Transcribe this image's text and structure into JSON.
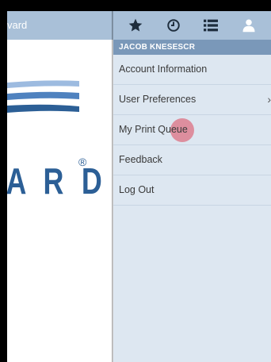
{
  "left_header": {
    "title": "vard"
  },
  "logo": {
    "text": "A R D",
    "registered": "®"
  },
  "icons": [
    "star-icon",
    "clock-icon",
    "list-icon",
    "user-icon"
  ],
  "user": {
    "name": "JACOB KNESESCR"
  },
  "menu": {
    "items": [
      {
        "label": "Account Information"
      },
      {
        "label": "User Preferences"
      },
      {
        "label": "My Print Queue"
      },
      {
        "label": "Feedback"
      },
      {
        "label": "Log Out"
      }
    ]
  },
  "colors": {
    "header": "#a9c0d8",
    "user_bar": "#7a98b9",
    "menu_bg": "#dde7f1",
    "logo_blue": "#2c5f96"
  }
}
